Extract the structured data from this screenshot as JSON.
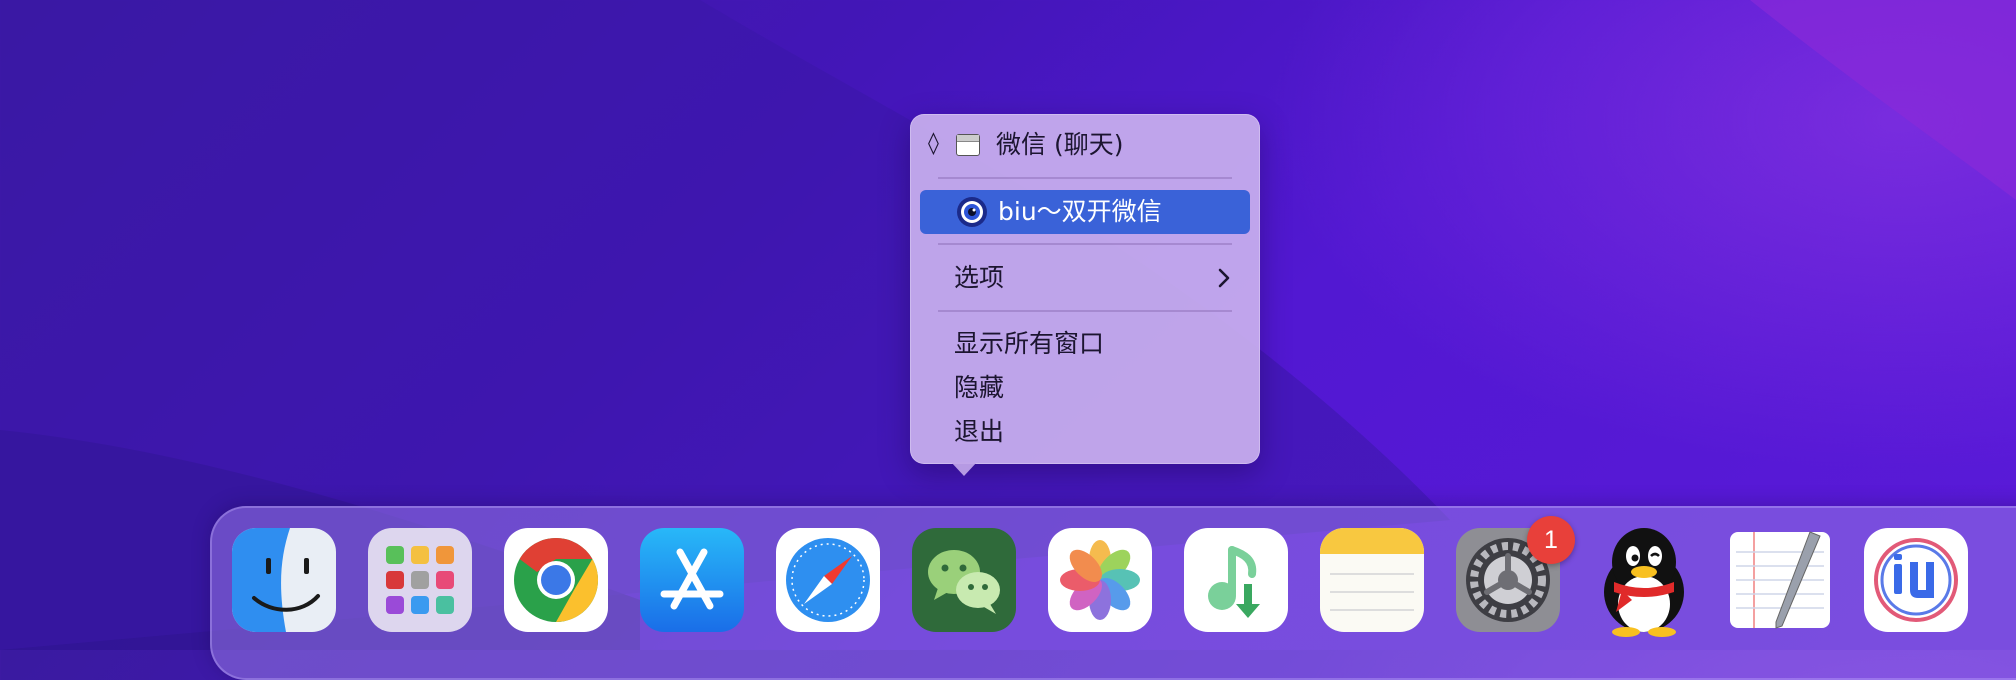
{
  "menu": {
    "window_item": "微信 (聊天)",
    "highlighted_item": "biu～双开微信",
    "options": "选项",
    "show_all_windows": "显示所有窗口",
    "hide": "隐藏",
    "quit": "退出",
    "highlight_color": "#3a62d8"
  },
  "dock": {
    "apps": [
      {
        "name": "finder-icon"
      },
      {
        "name": "launchpad-icon"
      },
      {
        "name": "chrome-icon"
      },
      {
        "name": "app-store-icon"
      },
      {
        "name": "safari-icon"
      },
      {
        "name": "wechat-icon"
      },
      {
        "name": "photos-icon"
      },
      {
        "name": "music-downloader-icon"
      },
      {
        "name": "notes-icon"
      },
      {
        "name": "system-preferences-icon"
      },
      {
        "name": "qq-icon"
      },
      {
        "name": "textedit-icon"
      },
      {
        "name": "iu-app-icon"
      }
    ],
    "system_prefs_badge": "1"
  }
}
